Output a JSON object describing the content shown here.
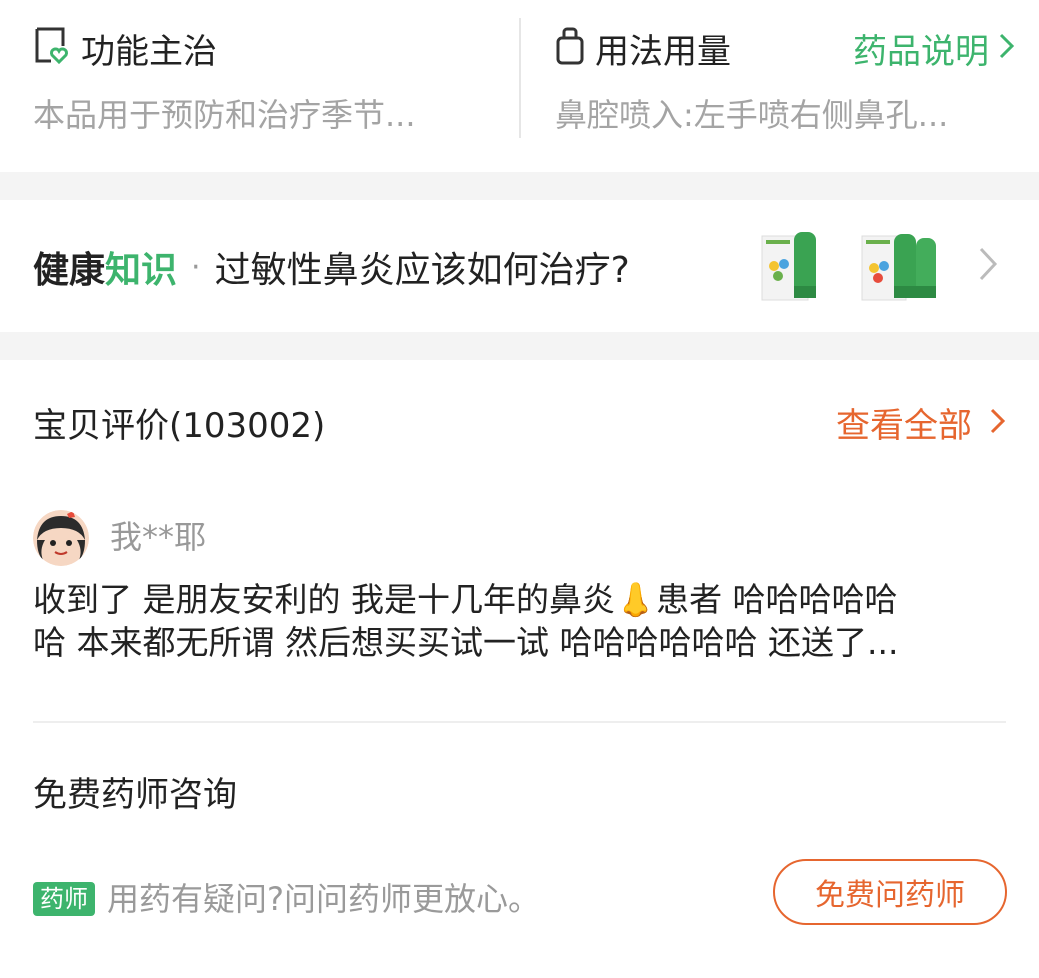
{
  "drug_info": {
    "function": {
      "label": "功能主治",
      "icon": "shield-heart-icon",
      "description": "本品用于预防和治疗季节..."
    },
    "usage": {
      "label": "用法用量",
      "icon": "bottle-icon",
      "description": "鼻腔喷入:左手喷右侧鼻孔...",
      "link_label": "药品说明"
    }
  },
  "health": {
    "prefix_bold": "健康",
    "prefix_green": "知识",
    "separator": "·",
    "question": "过敏性鼻炎应该如何治疗?"
  },
  "reviews": {
    "header": "宝贝评价(103002)",
    "view_all_label": "查看全部",
    "items": [
      {
        "user": "我**耶",
        "text_line1": "收到了 是朋友安利的 我是十几年的鼻炎👃患者 哈哈哈哈哈",
        "text_line2": "哈 本来都无所谓 然后想买买试一试 哈哈哈哈哈哈 还送了..."
      }
    ]
  },
  "consult": {
    "title": "免费药师咨询",
    "badge": "药师",
    "tip": "用药有疑问?问问药师更放心。",
    "button_label": "免费问药师"
  },
  "colors": {
    "green": "#3db46d",
    "orange": "#e6662f",
    "gray_text": "#a4a4a4",
    "divider_bg": "#f4f4f4"
  }
}
